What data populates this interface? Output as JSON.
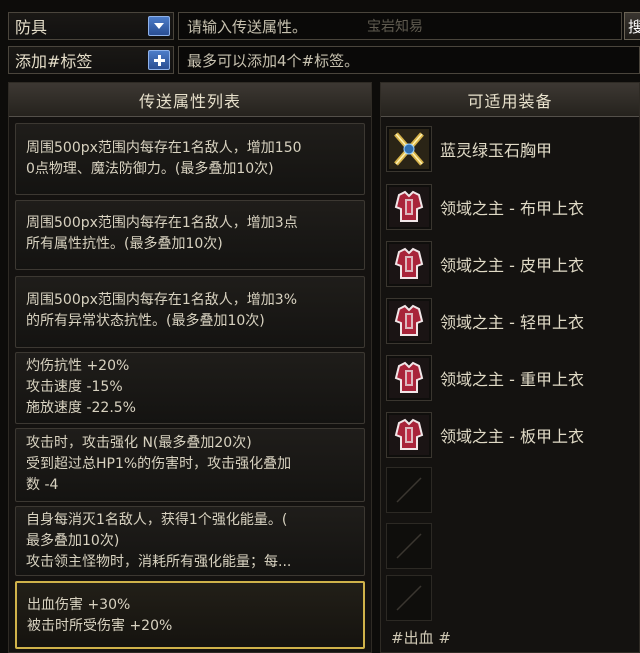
{
  "top": {
    "category": "防具",
    "category_icon": "chevron-down-icon",
    "search_placeholder": "请输入传送属性。",
    "search_overlay": "宝岩知易",
    "edge_button": "搜",
    "tag_dropdown": "添加#标签",
    "tag_add_icon": "plus-icon",
    "tag_hint": "最多可以添加4个#标签。"
  },
  "left_panel": {
    "title": "传送属性列表",
    "attributes": [
      {
        "lines": [
          "周围500px范围内每存在1名敌人，增加150",
          "0点物理、魔法防御力。(最多叠加10次)"
        ]
      },
      {
        "lines": [
          "周围500px范围内每存在1名敌人，增加3点",
          "所有属性抗性。(最多叠加10次)"
        ]
      },
      {
        "lines": [
          "周围500px范围内每存在1名敌人，增加3%",
          "的所有异常状态抗性。(最多叠加10次)"
        ]
      },
      {
        "lines": [
          "灼伤抗性 +20%",
          "攻击速度 -15%",
          "施放速度 -22.5%"
        ]
      },
      {
        "lines": [
          "攻击时，攻击强化 N(最多叠加20次)",
          "受到超过总HP1%的伤害时，攻击强化叠加",
          "数 -4"
        ]
      },
      {
        "lines": [
          "自身每消灭1名敌人，获得1个强化能量。(",
          "最多叠加10次)",
          "攻击领主怪物时，消耗所有强化能量；每..."
        ]
      },
      {
        "lines": [
          "出血伤害 +30%",
          "被击时所受伤害 +20%"
        ]
      }
    ]
  },
  "right_panel": {
    "title": "可适用装备",
    "items": [
      {
        "name": "蓝灵绿玉石胸甲",
        "icon": "breastplate-icon"
      },
      {
        "name": "领域之主 - 布甲上衣",
        "icon": "armor-icon"
      },
      {
        "name": "领域之主 - 皮甲上衣",
        "icon": "armor-icon"
      },
      {
        "name": "领域之主 - 轻甲上衣",
        "icon": "armor-icon"
      },
      {
        "name": "领域之主 - 重甲上衣",
        "icon": "armor-icon"
      },
      {
        "name": "领域之主 - 板甲上衣",
        "icon": "armor-icon"
      }
    ],
    "tag_text": "#出血 #",
    "colors": {
      "accent": "#cfb24a",
      "button_blue": "#3a64ad"
    }
  }
}
